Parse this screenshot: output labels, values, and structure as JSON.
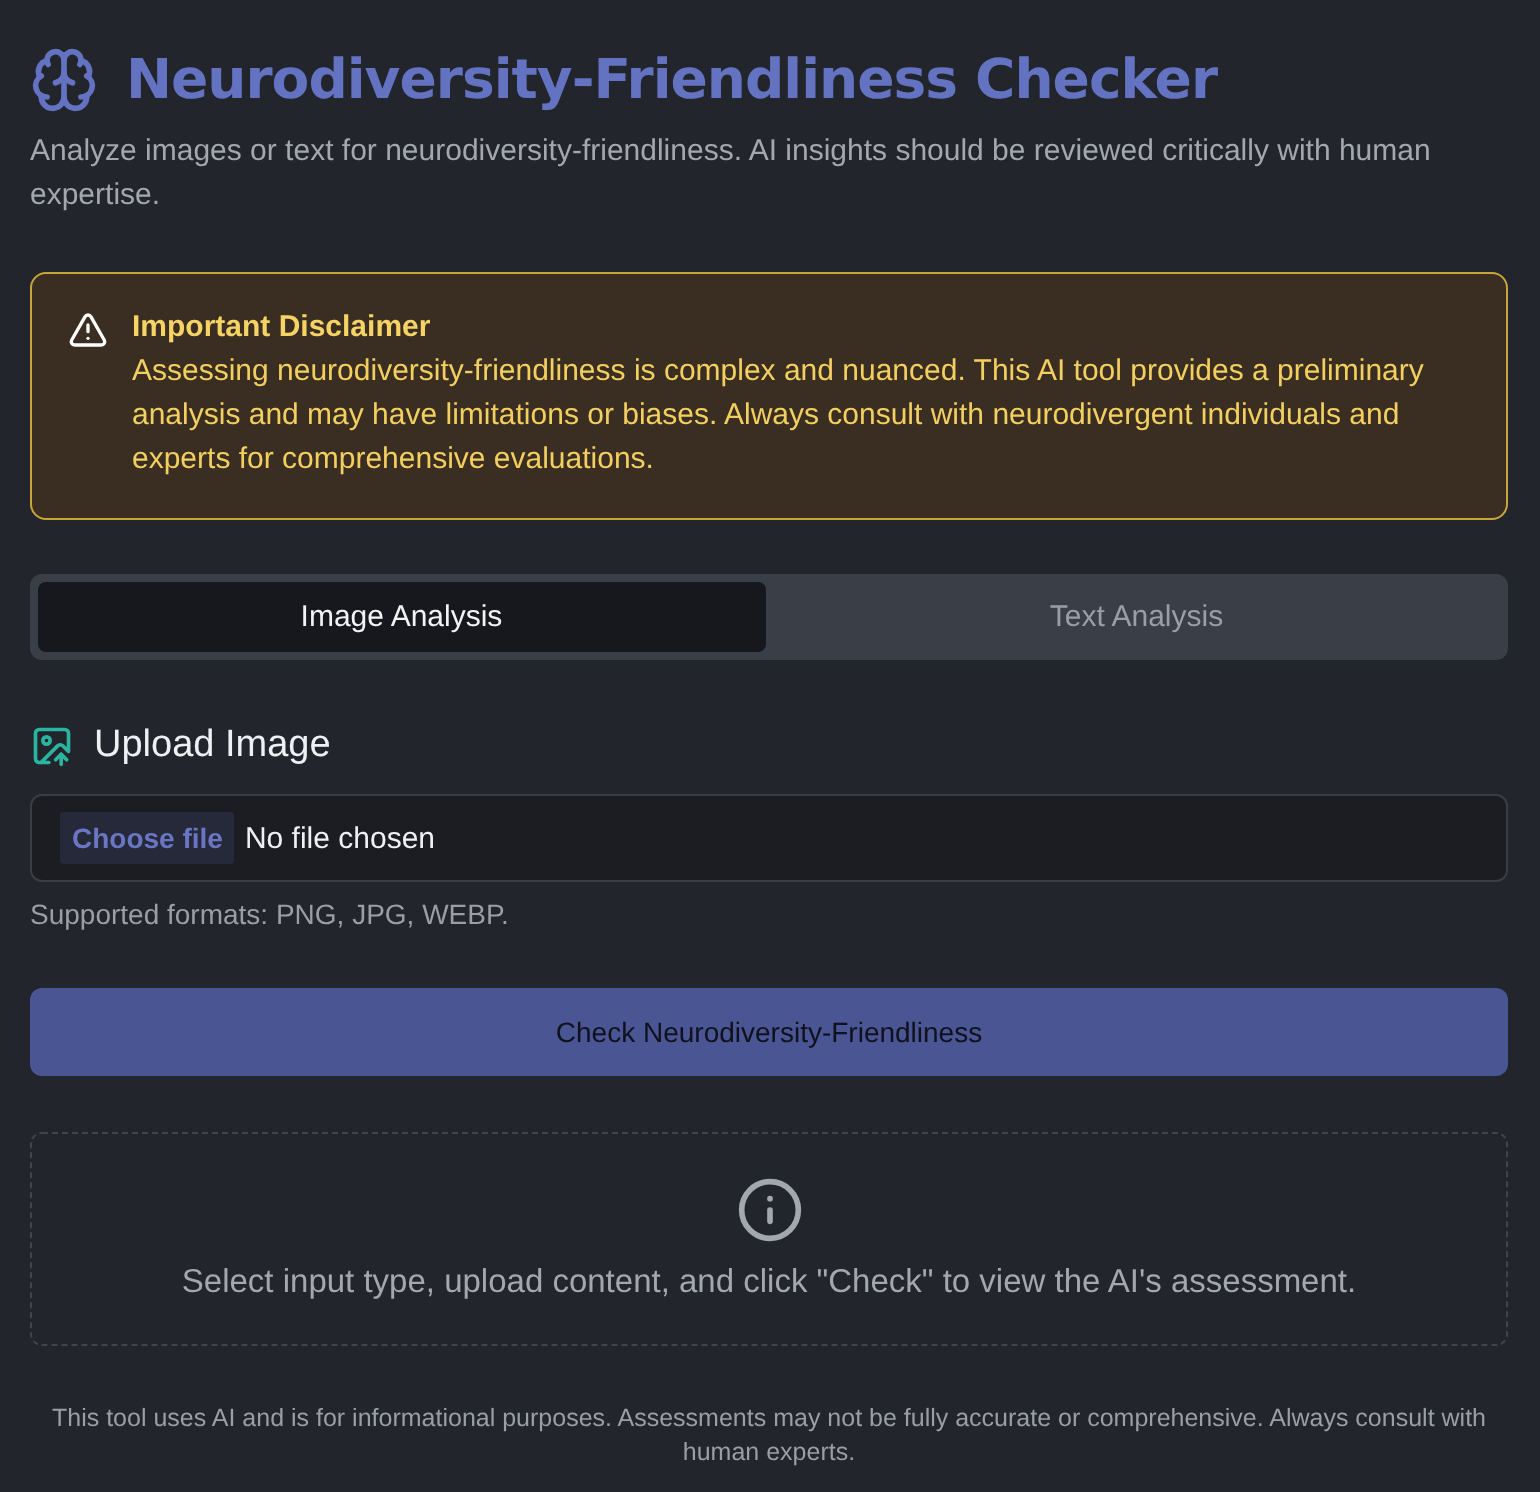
{
  "header": {
    "title": "Neurodiversity-Friendliness Checker",
    "subtitle": "Analyze images or text for neurodiversity-friendliness. AI insights should be reviewed critically with human expertise."
  },
  "disclaimer": {
    "title": "Important Disclaimer",
    "body": "Assessing neurodiversity-friendliness is complex and nuanced. This AI tool provides a preliminary analysis and may have limitations or biases. Always consult with neurodivergent individuals and experts for comprehensive evaluations."
  },
  "tabs": [
    {
      "label": "Image Analysis",
      "selected": true
    },
    {
      "label": "Text Analysis",
      "selected": false
    }
  ],
  "upload": {
    "heading": "Upload Image",
    "choose_button": "Choose file",
    "file_status": "No file chosen",
    "hint": "Supported formats: PNG, JPG, WEBP."
  },
  "check_button": {
    "label": "Check Neurodiversity-Friendliness",
    "disabled": true
  },
  "result_placeholder": {
    "message": "Select input type, upload content, and click \"Check\" to view the AI's assessment."
  },
  "footer": "This tool uses AI and is for informational purposes. Assessments may not be fully accurate or comprehensive. Always consult with human experts."
}
